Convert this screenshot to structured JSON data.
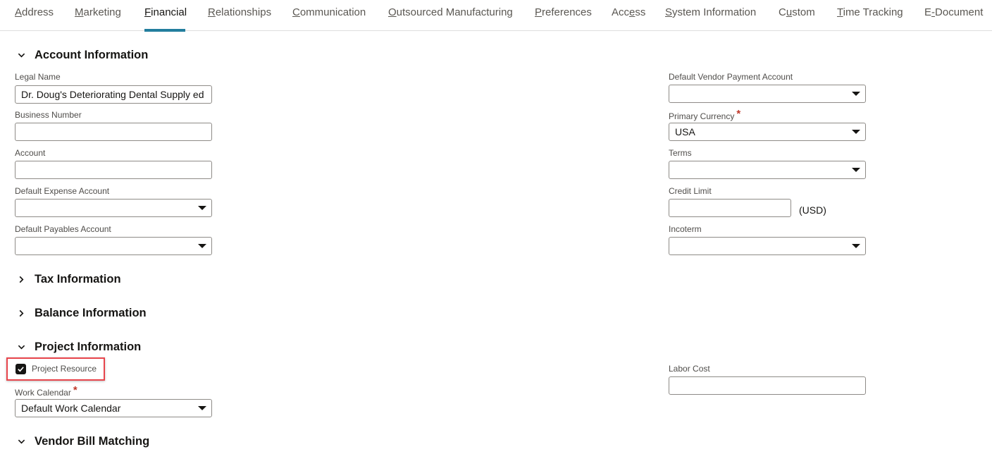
{
  "tabs": [
    {
      "pre": "",
      "key": "A",
      "post": "ddress",
      "active": false
    },
    {
      "pre": "",
      "key": "M",
      "post": "arketing",
      "active": false
    },
    {
      "pre": "",
      "key": "F",
      "post": "inancial",
      "active": true
    },
    {
      "pre": "",
      "key": "R",
      "post": "elationships",
      "active": false
    },
    {
      "pre": "",
      "key": "C",
      "post": "ommunication",
      "active": false
    },
    {
      "pre": "",
      "key": "O",
      "post": "utsourced Manufacturing",
      "active": false
    },
    {
      "pre": "",
      "key": "P",
      "post": "references",
      "active": false
    },
    {
      "pre": "Acc",
      "key": "e",
      "post": "ss",
      "active": false
    },
    {
      "pre": "",
      "key": "S",
      "post": "ystem Information",
      "active": false
    },
    {
      "pre": "C",
      "key": "u",
      "post": "stom",
      "active": false
    },
    {
      "pre": "",
      "key": "T",
      "post": "ime Tracking",
      "active": false
    },
    {
      "pre": "E",
      "key": "-",
      "post": "Document",
      "active": false
    }
  ],
  "sections": {
    "account": {
      "title": "Account Information",
      "expanded": true
    },
    "tax": {
      "title": "Tax Information",
      "expanded": false
    },
    "balance": {
      "title": "Balance Information",
      "expanded": false
    },
    "project": {
      "title": "Project Information",
      "expanded": true
    },
    "vendor_bill": {
      "title": "Vendor Bill Matching",
      "expanded": true
    }
  },
  "account_fields": {
    "legal_name": {
      "label": "Legal Name",
      "value": "Dr. Doug's Deteriorating Dental Supply ed"
    },
    "business_number": {
      "label": "Business Number",
      "value": ""
    },
    "account": {
      "label": "Account",
      "value": ""
    },
    "default_expense_account": {
      "label": "Default Expense Account",
      "value": ""
    },
    "default_payables_account": {
      "label": "Default Payables Account",
      "value": ""
    },
    "default_vendor_payment_account": {
      "label": "Default Vendor Payment Account",
      "value": ""
    },
    "primary_currency": {
      "label": "Primary Currency",
      "value": "USA",
      "required_mark": "*"
    },
    "terms": {
      "label": "Terms",
      "value": ""
    },
    "credit_limit": {
      "label": "Credit Limit",
      "value": "",
      "suffix": "(USD)"
    },
    "incoterm": {
      "label": "Incoterm",
      "value": ""
    }
  },
  "project_fields": {
    "project_resource": {
      "label": "Project Resource",
      "checked": true
    },
    "work_calendar": {
      "label": "Work Calendar",
      "value": "Default Work Calendar",
      "required_mark": "*"
    },
    "labor_cost": {
      "label": "Labor Cost",
      "value": ""
    }
  },
  "colors": {
    "accent": "#227e9e",
    "required": "#c0392b",
    "highlight": "#e8454c"
  }
}
